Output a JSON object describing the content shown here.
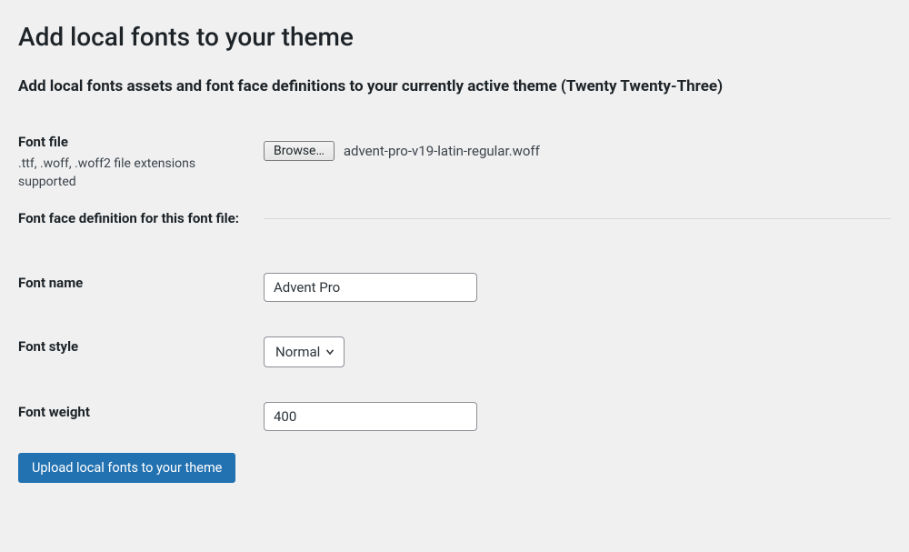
{
  "page": {
    "title": "Add local fonts to your theme",
    "subtitle": "Add local fonts assets and font face definitions to your currently active theme (Twenty Twenty-Three)"
  },
  "fields": {
    "font_file": {
      "label": "Font file",
      "hint": ".ttf, .woff, .woff2 file extensions supported",
      "browse_label": "Browse…",
      "selected_file": "advent-pro-v19-latin-regular.woff"
    },
    "divider": {
      "label": "Font face definition for this font file:"
    },
    "font_name": {
      "label": "Font name",
      "value": "Advent Pro"
    },
    "font_style": {
      "label": "Font style",
      "value": "Normal"
    },
    "font_weight": {
      "label": "Font weight",
      "value": "400"
    }
  },
  "submit": {
    "label": "Upload local fonts to your theme"
  }
}
